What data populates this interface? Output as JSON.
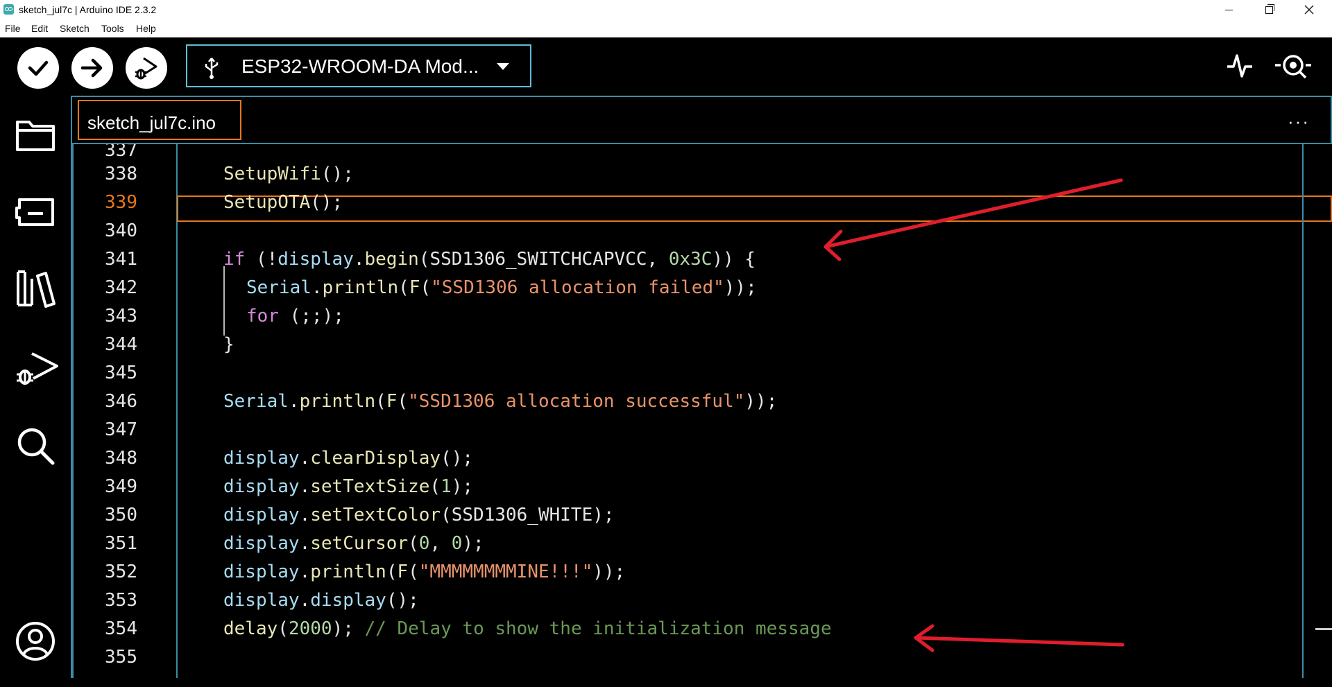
{
  "window": {
    "title": "sketch_jul7c | Arduino IDE 2.3.2"
  },
  "menu": [
    "File",
    "Edit",
    "Sketch",
    "Tools",
    "Help"
  ],
  "toolbar": {
    "verify_icon": "check-icon",
    "upload_icon": "arrow-right-icon",
    "debug_icon": "debug-play-icon",
    "board": "ESP32-WROOM-DA Mod...",
    "serial_plotter_icon": "pulse-icon",
    "serial_monitor_icon": "magnifier-icon"
  },
  "sidebar": {
    "items": [
      "folder-icon",
      "board-icon",
      "library-icon",
      "debug-icon",
      "search-icon"
    ],
    "bottom": "account-icon"
  },
  "tabs": {
    "active": "sketch_jul7c.ino",
    "more": "···"
  },
  "editor": {
    "active_line": "339",
    "lines": [
      {
        "n": "337",
        "code": ""
      },
      {
        "n": "338",
        "code": "SetupWifi();"
      },
      {
        "n": "339",
        "code": "SetupOTA();"
      },
      {
        "n": "340",
        "code": ""
      },
      {
        "n": "341",
        "code": "if (!display.begin(SSD1306_SWITCHCAPVCC, 0x3C)) {"
      },
      {
        "n": "342",
        "code": "Serial.println(F(\"SSD1306 allocation failed\"));"
      },
      {
        "n": "343",
        "code": "for (;;);"
      },
      {
        "n": "344",
        "code": "}"
      },
      {
        "n": "345",
        "code": ""
      },
      {
        "n": "346",
        "code": "Serial.println(F(\"SSD1306 allocation successful\"));"
      },
      {
        "n": "347",
        "code": ""
      },
      {
        "n": "348",
        "code": "display.clearDisplay();"
      },
      {
        "n": "349",
        "code": "display.setTextSize(1);"
      },
      {
        "n": "350",
        "code": "display.setTextColor(SSD1306_WHITE);"
      },
      {
        "n": "351",
        "code": "display.setCursor(0, 0);"
      },
      {
        "n": "352",
        "code": "display.println(F(\"MMMMMMMMINE!!!\"));"
      },
      {
        "n": "353",
        "code": "display.display();"
      },
      {
        "n": "354",
        "code": "delay(2000); // Delay to show the initialization message"
      },
      {
        "n": "355",
        "code": ""
      }
    ]
  },
  "colors": {
    "accent_border": "#3a8da6",
    "active_tab": "#e8781a",
    "annotation_arrow": "#e01e2b"
  }
}
